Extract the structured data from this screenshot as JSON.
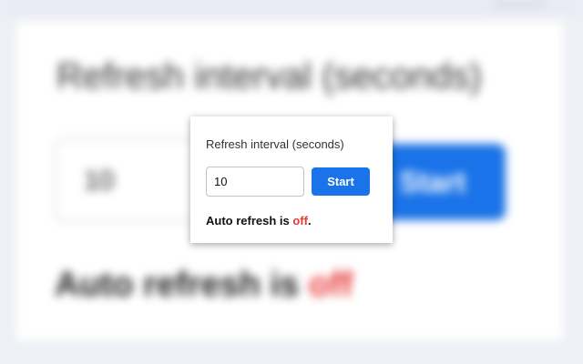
{
  "popup": {
    "label": "Refresh interval (seconds)",
    "interval_value": "10",
    "start_label": "Start",
    "status_prefix": "Auto refresh is ",
    "status_value": "off",
    "status_suffix": "."
  },
  "colors": {
    "accent": "#1a73e8",
    "status_off": "#e53935"
  }
}
